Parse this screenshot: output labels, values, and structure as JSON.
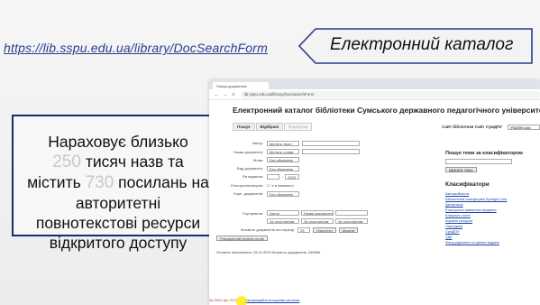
{
  "slide": {
    "url": "https://lib.sspu.edu.ua/library/DocSearchForm",
    "title": "Електронний каталог",
    "stats": {
      "line1": "Нараховує близько",
      "num_titles": "250",
      "line2": "тисяч назв та",
      "line3a": "містить",
      "num_links": "730",
      "line3b": "посилань на",
      "line4": "авторитетні",
      "line5": "повнотекстові ресурси",
      "line6": "відкритого доступу"
    }
  },
  "browser": {
    "tab_title": "Пошук документів",
    "address": "lib.sspu.edu.ua/library/DocSearchForm",
    "nav_glyphs": "← → C",
    "page_header": "Електронний каталог бібліотеки Сумського державного педагогічного університету",
    "tabs": [
      "Пошук",
      "Відібрані",
      "Формуляр"
    ],
    "sites_label": "Сайт бібліотеки  Сайт СумДПУ",
    "lang_value": "Українська",
    "form_rows": [
      {
        "label": "Автор:",
        "select": "Містить текст"
      },
      {
        "label": "Назва документа:",
        "select": "Містить слова"
      },
      {
        "label": "Мова:",
        "select": "Без обмежень"
      },
      {
        "label": "Вид документа:",
        "select": "Без обмежень"
      },
      {
        "label": "Рік видання:",
        "select": "2023"
      },
      {
        "label": "Електронна версія:",
        "select": "є в наявності"
      },
      {
        "label": "Корп. документів:",
        "select": "Без обмежень"
      }
    ],
    "sort_label": "Сортування:",
    "sort_values": [
      "Автор",
      "Назва документа",
      "За зростанням"
    ],
    "count_label": "Кількість документів на сторінці:",
    "count_value": "25",
    "clear_button": "Очистити",
    "search_button": "Шукати",
    "extended_label": "Розширений перелік полів",
    "last_update": "Останнє поповнення: 15.12.2023    Кількість документів: 249866",
    "right": {
      "class_search": "Пошук теми за класифікатором",
      "class_button": "Шукати тему",
      "classifiers": "Класифікатори",
      "links": [
        "Автомобілісти",
        "Бібліотечна платформа Springer Link",
        "Дисертації",
        "Електронні навчальні видання",
        "Класичні статті",
        "Корисні ресурси",
        "Періодика",
        "СумДПУ",
        "УДК",
        "Фонд рідкісних та цінних видань"
      ]
    },
    "bottom_text": "За 2023 рік: 2174",
    "bottom_link": "Інформаційно-пошукова система"
  }
}
